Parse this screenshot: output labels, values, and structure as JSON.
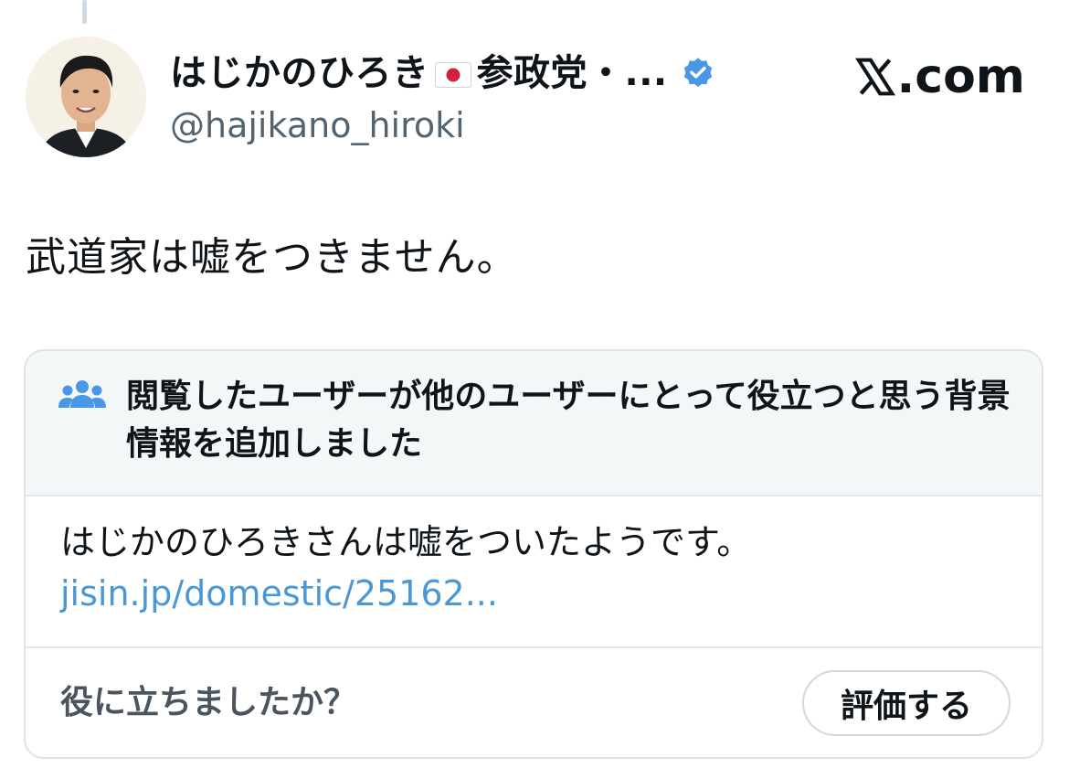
{
  "tweet": {
    "author": {
      "display_name": "はじかのひろき",
      "display_name_suffix": "参政党・...",
      "flag_icon": "japan-flag-icon",
      "verified_icon": "verified-badge-icon",
      "handle": "@hajikano_hiroki"
    },
    "text": "武道家は嘘をつきません。"
  },
  "brand": {
    "text": ".com",
    "logo_icon": "x-logo-icon"
  },
  "community_note": {
    "icon": "people-icon",
    "title": "閲覧したユーザーが他のユーザーにとって役立つと思う背景情報を追加しました",
    "body_text": "はじかのひろきさんは嘘をついたようです。",
    "link_text": "jisin.jp/domestic/25162...",
    "helpful_question": "役に立ちましたか？",
    "rate_button_label": "評価する"
  },
  "colors": {
    "verified_blue": "#4a97e8",
    "link_blue": "#4a97d6",
    "handle_gray": "#536471",
    "note_header_bg": "#f4f7f8",
    "people_icon_blue": "#4a97e8"
  }
}
